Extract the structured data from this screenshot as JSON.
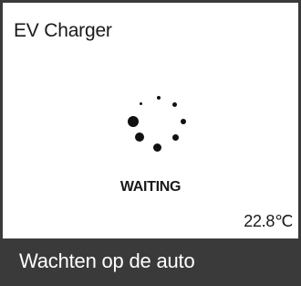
{
  "header": {
    "title": "EV Charger"
  },
  "status": {
    "label": "WAITING",
    "icon": "loading-spinner-icon"
  },
  "temperature": {
    "display": "22.8℃"
  },
  "footer": {
    "message": "Wachten op de auto"
  },
  "colors": {
    "background": "#ffffff",
    "footer_bar": "#3a3a3a",
    "text": "#1a1a1a",
    "footer_text": "#ffffff"
  }
}
